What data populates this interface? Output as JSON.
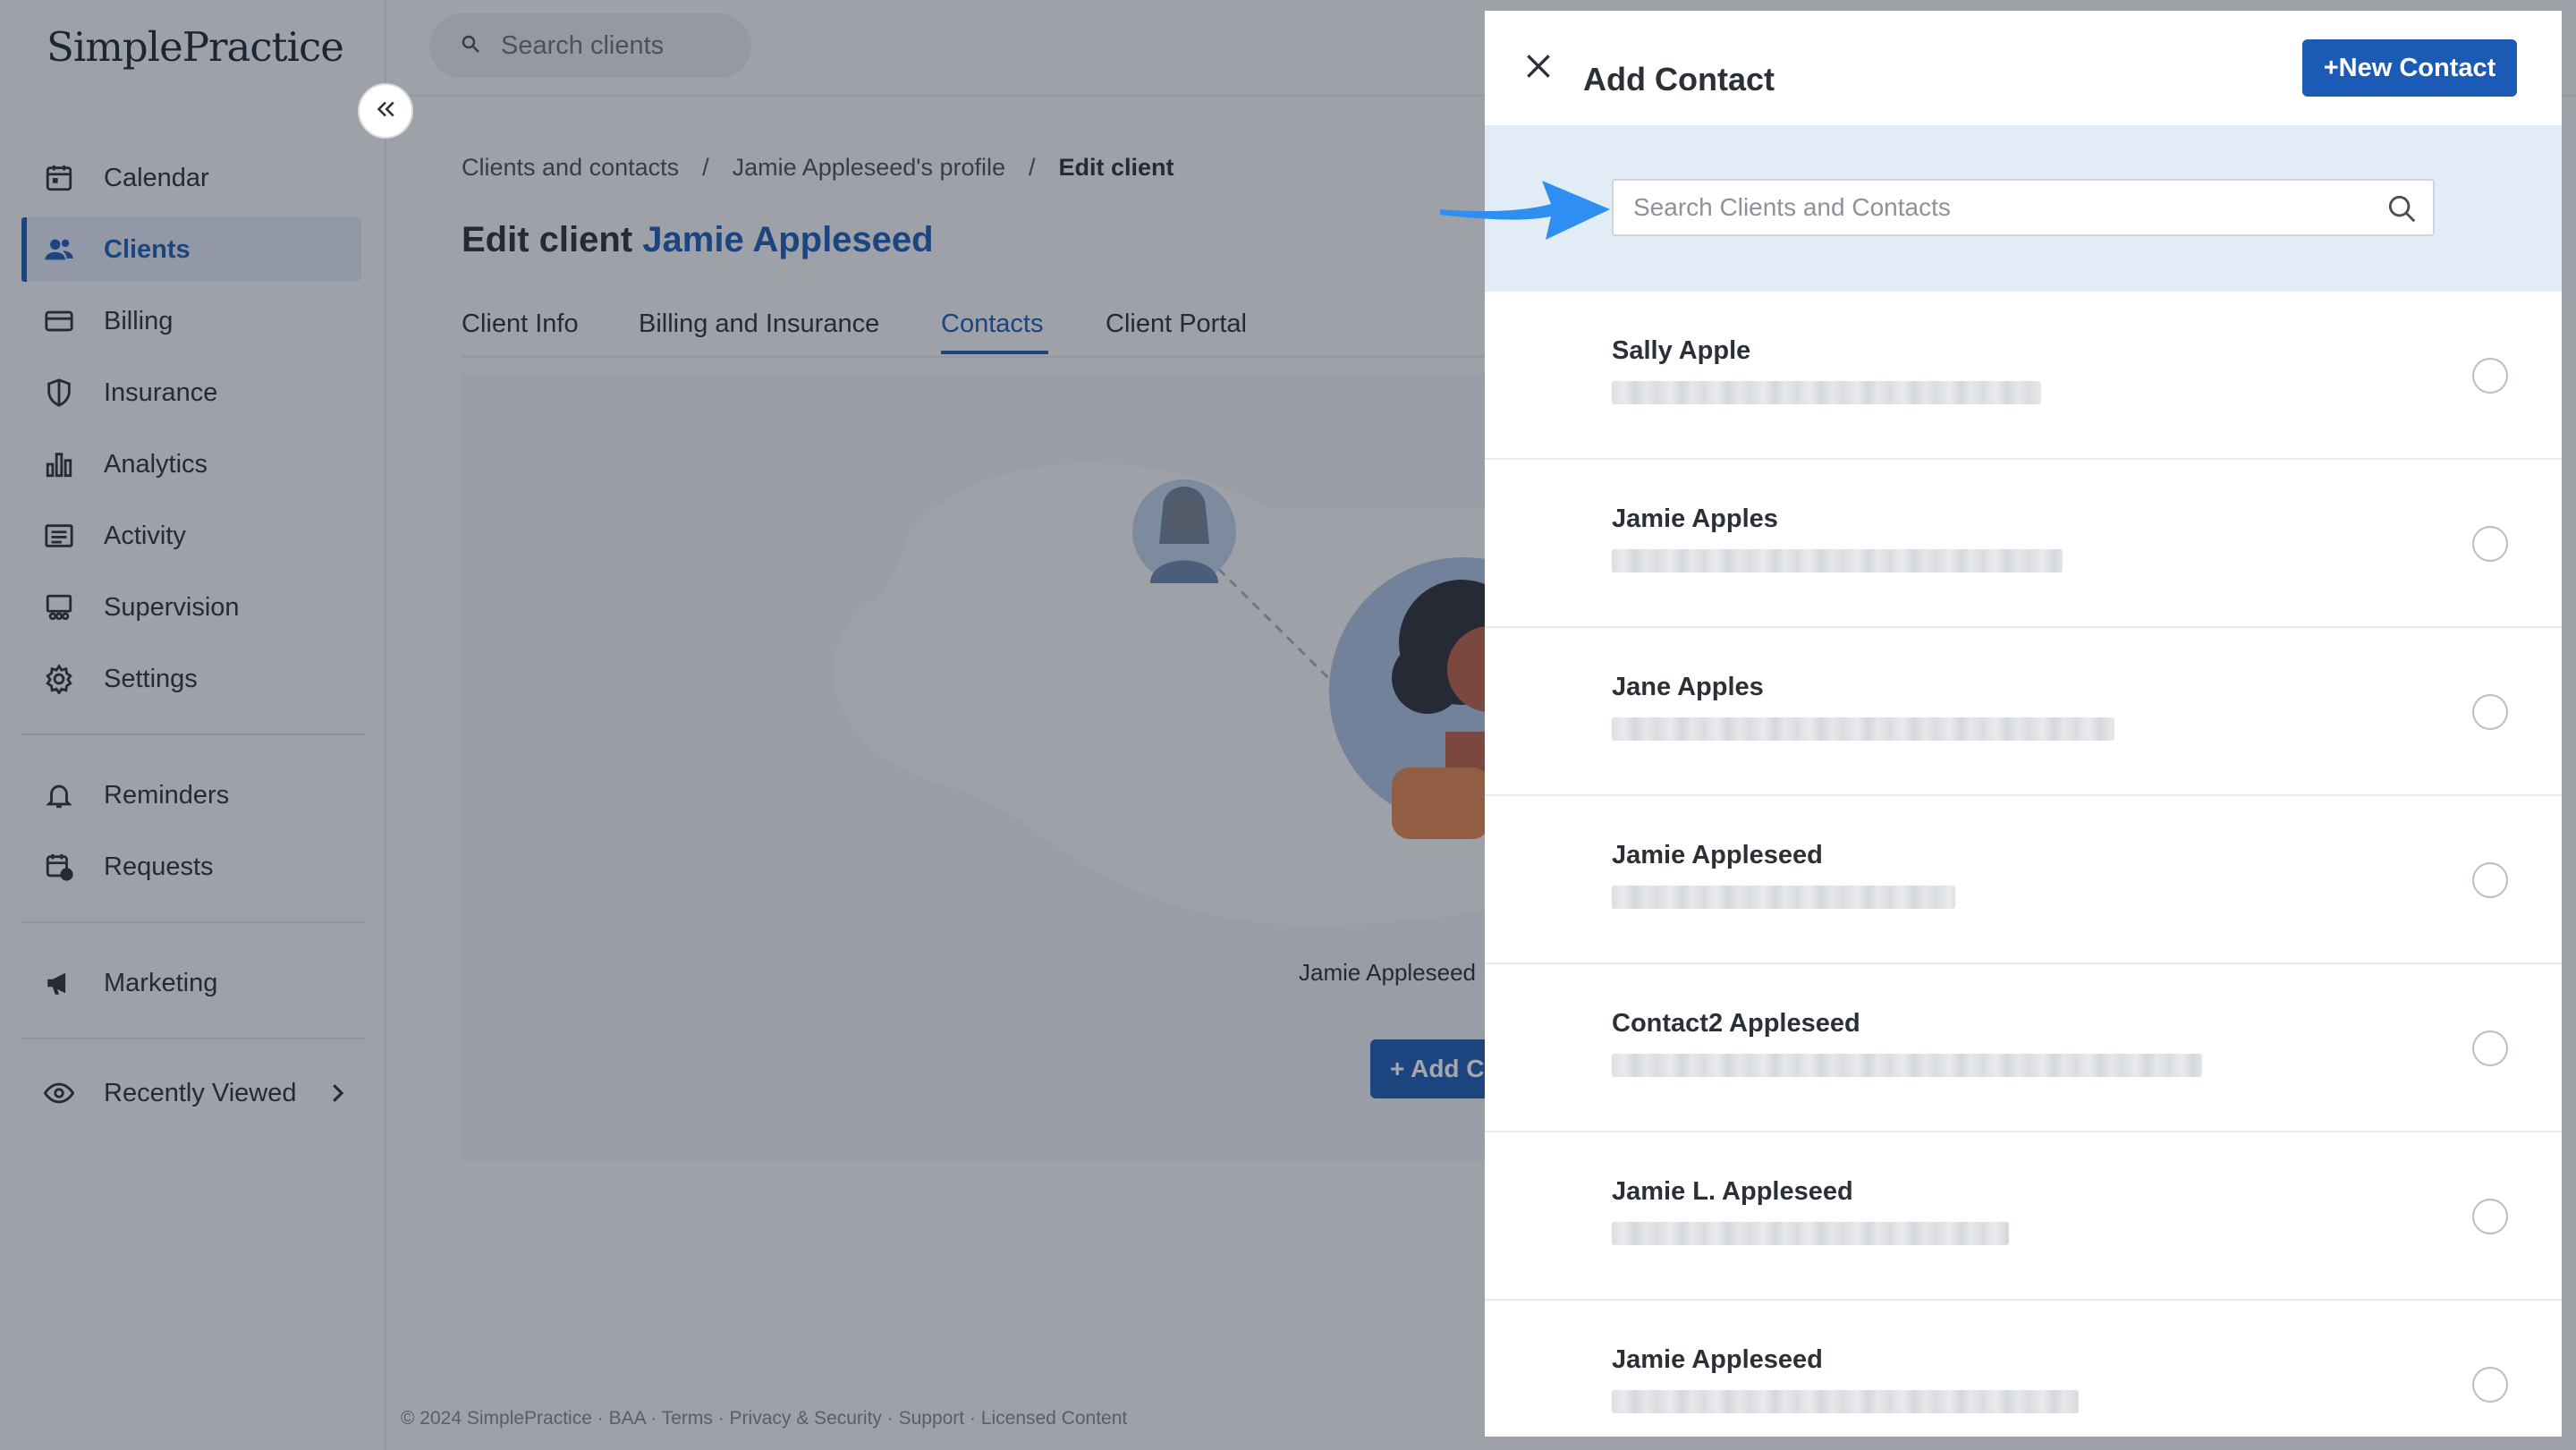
{
  "app": {
    "logo_text": "SimplePractice"
  },
  "sidebar": {
    "items": [
      {
        "label": "Calendar",
        "icon": "calendar-icon"
      },
      {
        "label": "Clients",
        "icon": "clients-icon",
        "active": true
      },
      {
        "label": "Billing",
        "icon": "billing-card-icon"
      },
      {
        "label": "Insurance",
        "icon": "shield-icon"
      },
      {
        "label": "Analytics",
        "icon": "bar-chart-icon"
      },
      {
        "label": "Activity",
        "icon": "activity-list-icon"
      },
      {
        "label": "Supervision",
        "icon": "supervision-icon"
      },
      {
        "label": "Settings",
        "icon": "gear-icon"
      },
      {
        "label": "Reminders",
        "icon": "bell-icon"
      },
      {
        "label": "Requests",
        "icon": "calendar-request-icon"
      },
      {
        "label": "Marketing",
        "icon": "megaphone-icon"
      },
      {
        "label": "Recently Viewed",
        "icon": "eye-icon"
      }
    ]
  },
  "topbar": {
    "search_placeholder": "Search clients"
  },
  "breadcrumb": {
    "items": [
      "Clients and contacts",
      "Jamie Appleseed's profile",
      "Edit client"
    ],
    "separator": "/"
  },
  "page": {
    "title_prefix": "Edit client",
    "client_name": "Jamie Appleseed"
  },
  "tabs": [
    "Client Info",
    "Billing and Insurance",
    "Contacts",
    "Client Portal"
  ],
  "active_tab": "Contacts",
  "empty_state": {
    "name_label": "Jamie Appleseed",
    "add_button": "+ Add C"
  },
  "footer": {
    "text": "© 2024 SimplePractice · BAA · Terms · Privacy & Security · Support · Licensed Content"
  },
  "drawer": {
    "title": "Add Contact",
    "new_contact_button": "+New Contact",
    "search_placeholder": "Search Clients and Contacts",
    "contacts": [
      {
        "name": "Sally Apple",
        "selected": false
      },
      {
        "name": "Jamie Apples",
        "selected": false
      },
      {
        "name": "Jane Apples",
        "selected": false
      },
      {
        "name": "Jamie Appleseed",
        "selected": false
      },
      {
        "name": "Contact2 Appleseed",
        "selected": false
      },
      {
        "name": "Jamie L. Appleseed",
        "selected": false
      },
      {
        "name": "Jamie Appleseed",
        "selected": false
      }
    ]
  },
  "colors": {
    "brand_blue": "#1b5bb5",
    "annotation_arrow": "#2f8ff0",
    "search_band": "#e2ecf7"
  }
}
